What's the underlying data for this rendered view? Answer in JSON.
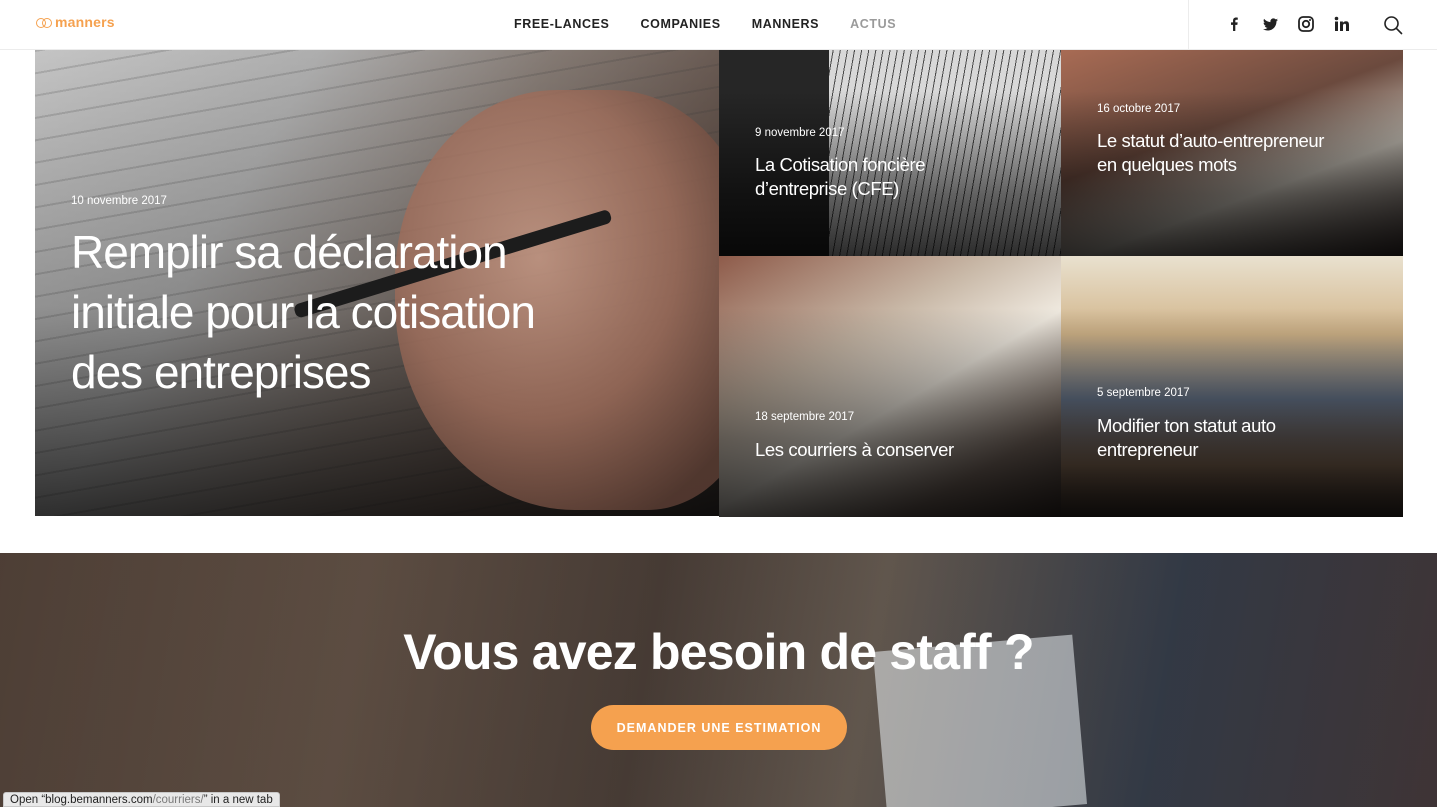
{
  "brand": {
    "logo_text": "manners",
    "accent_color": "#f5a14f"
  },
  "nav": {
    "items": [
      {
        "label": "FREE-LANCES"
      },
      {
        "label": "COMPANIES"
      },
      {
        "label": "MANNERS"
      },
      {
        "label": "ACTUS"
      }
    ]
  },
  "socials": {
    "icons": [
      "facebook-icon",
      "twitter-icon",
      "instagram-icon",
      "linkedin-icon",
      "search-icon"
    ]
  },
  "featured": {
    "date": "10 novembre 2017",
    "title": "Remplir sa déclaration initiale pour la cotisation des entreprises"
  },
  "posts": [
    {
      "date": "9 novembre 2017",
      "title": "La Cotisation foncière d’entreprise (CFE)"
    },
    {
      "date": "16 octobre 2017",
      "title": "Le statut d’auto-entrepreneur en quelques mots"
    },
    {
      "date": "18 septembre 2017",
      "title": "Les courriers à conserver"
    },
    {
      "date": "5 septembre 2017",
      "title": "Modifier ton statut auto entrepreneur"
    }
  ],
  "cta": {
    "title": "Vous avez besoin de staff ?",
    "button_label": "DEMANDER UNE ESTIMATION"
  },
  "status_bar": {
    "prefix": "Open “blog.bemanners.com",
    "path": "/courriers/",
    "suffix": "” in a new tab"
  }
}
